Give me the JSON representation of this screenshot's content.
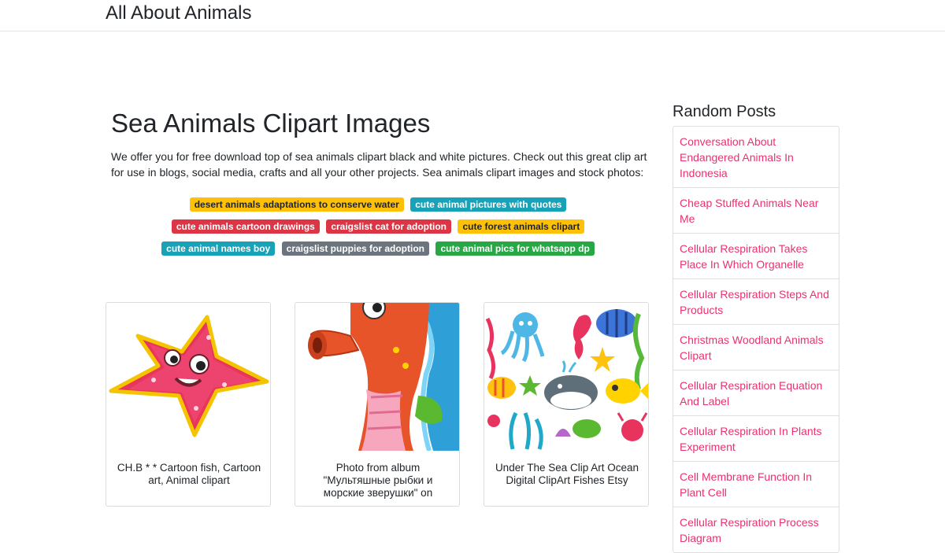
{
  "site": {
    "brand": "All About Animals"
  },
  "article": {
    "title": "Sea Animals Clipart Images",
    "intro": "We offer you for free download top of sea animals clipart black and white pictures. Check out this great clip art for use in blogs, social media, crafts and all your other projects. Sea animals clipart images and stock photos:"
  },
  "tags": [
    {
      "label": "desert animals adaptations to conserve water",
      "color": "#ffc107",
      "style": "warning"
    },
    {
      "label": "cute animal pictures with quotes",
      "color": "#17a2b8",
      "style": "info"
    },
    {
      "label": "cute animals cartoon drawings",
      "color": "#dc3545",
      "style": "danger"
    },
    {
      "label": "craigslist cat for adoption",
      "color": "#dc3545",
      "style": "danger"
    },
    {
      "label": "cute forest animals clipart",
      "color": "#ffc107",
      "style": "warning"
    },
    {
      "label": "cute animal names boy",
      "color": "#17a2b8",
      "style": "info"
    },
    {
      "label": "craigslist puppies for adoption",
      "color": "#6c757d",
      "style": "secondary"
    },
    {
      "label": "cute animal pics for whatsapp dp",
      "color": "#28a745",
      "style": "success"
    }
  ],
  "cards": [
    {
      "caption": "CH.B * * Cartoon fish, Cartoon art, Animal clipart",
      "image": "starfish-icon"
    },
    {
      "caption": "Photo from album \"Мультяшные рыбки и морские зверушки\" on",
      "image": "seahorse-icon"
    },
    {
      "caption": "Under The Sea Clip Art Ocean Digital ClipArt Fishes Etsy",
      "image": "sea-creatures-icon"
    }
  ],
  "sidebar": {
    "title": "Random Posts",
    "posts": [
      "Conversation About Endangered Animals In Indonesia",
      "Cheap Stuffed Animals Near Me",
      "Cellular Respiration Takes Place In Which Organelle",
      "Cellular Respiration Steps And Products",
      "Christmas Woodland Animals Clipart",
      "Cellular Respiration Equation And Label",
      "Cellular Respiration In Plants Experiment",
      "Cell Membrane Function In Plant Cell",
      "Cellular Respiration Process Diagram"
    ]
  },
  "colors": {
    "link": "#e8336e",
    "text": "#212529",
    "border": "#dfdfdf"
  }
}
